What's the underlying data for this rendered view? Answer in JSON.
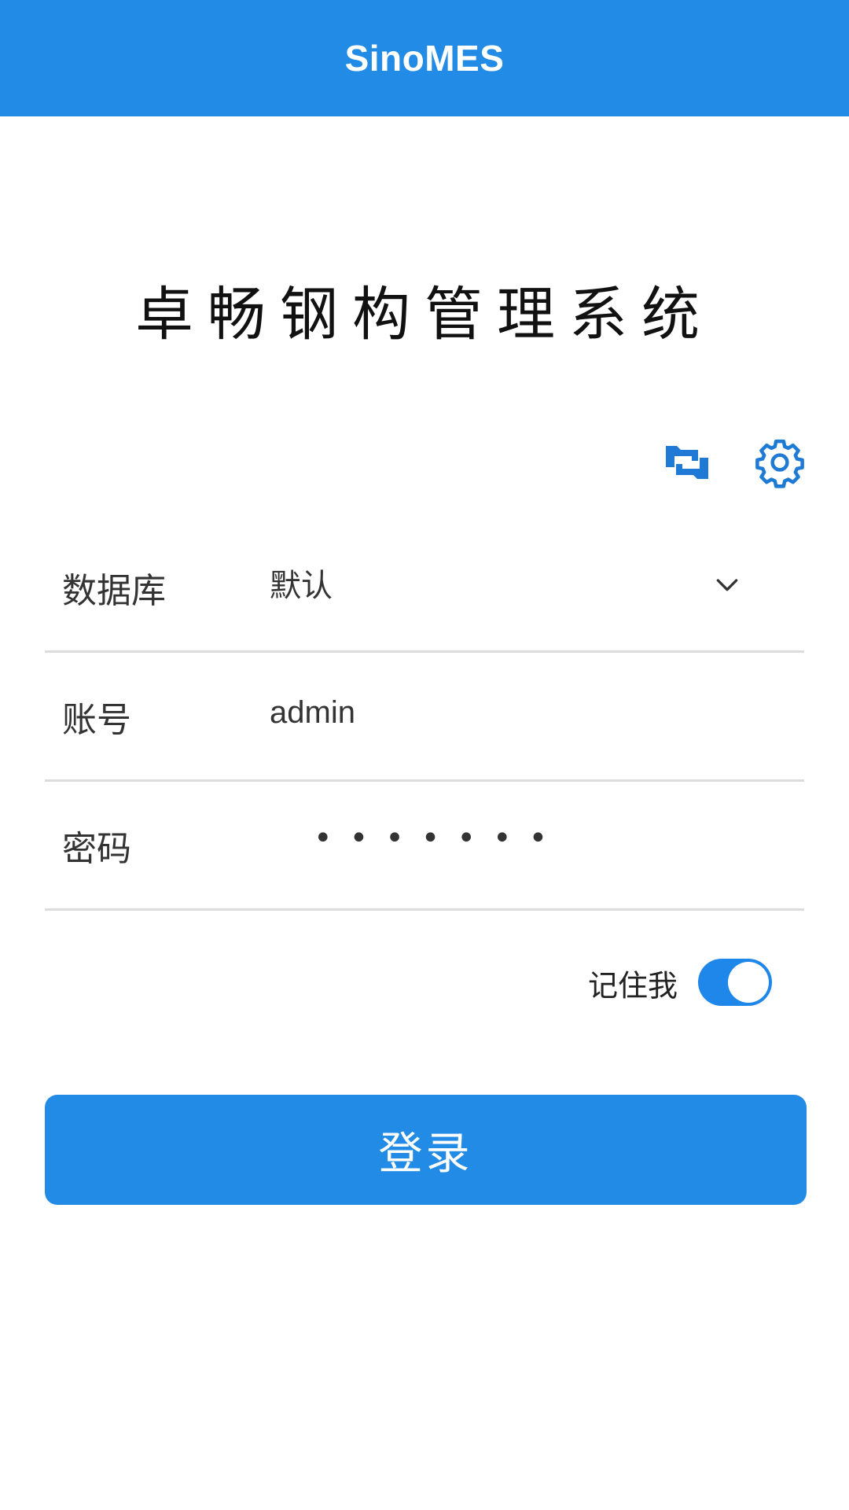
{
  "app_bar": {
    "title": "SinoMES"
  },
  "system_title": "卓畅钢构管理系统",
  "toolbar": {
    "switch_icon": "switch-account-icon",
    "settings_icon": "gear-icon"
  },
  "form": {
    "database": {
      "label": "数据库",
      "value": "默认",
      "dropdown_icon": "chevron-down-icon"
    },
    "account": {
      "label": "账号",
      "value": "admin"
    },
    "password": {
      "label": "密码",
      "masked_value": "•••••••"
    }
  },
  "remember_me": {
    "label": "记住我",
    "enabled": true
  },
  "login_button": {
    "label": "登录"
  },
  "colors": {
    "primary": "#228be6",
    "toggle_on": "#1f86ea",
    "divider": "#dcdcdc",
    "text": "#333333"
  }
}
